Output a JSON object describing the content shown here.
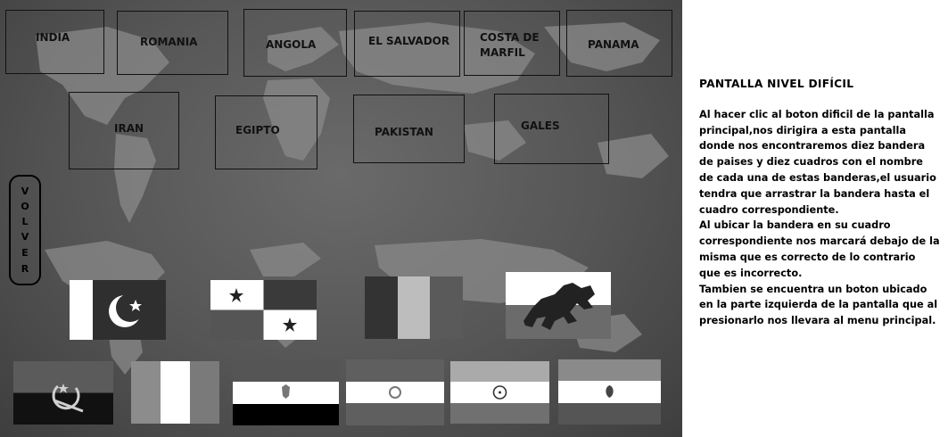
{
  "game": {
    "country_boxes": [
      {
        "id": "india",
        "label": "INDIA"
      },
      {
        "id": "romania",
        "label": "ROMANIA"
      },
      {
        "id": "angola",
        "label": "ANGOLA"
      },
      {
        "id": "el-salvador",
        "label": "EL SALVADOR"
      },
      {
        "id": "costa-de-marfil",
        "label": "COSTA DE\nMARFIL"
      },
      {
        "id": "panama",
        "label": "PANAMA"
      },
      {
        "id": "iran",
        "label": "IRAN"
      },
      {
        "id": "egipto",
        "label": "EGIPTO"
      },
      {
        "id": "pakistan",
        "label": "PAKISTAN"
      },
      {
        "id": "gales",
        "label": "GALES"
      }
    ],
    "volver_letters": [
      "V",
      "O",
      "L",
      "V",
      "E",
      "R"
    ],
    "flags": [
      {
        "id": "pakistan",
        "icon": "flag-pakistan"
      },
      {
        "id": "panama",
        "icon": "flag-panama"
      },
      {
        "id": "romania",
        "icon": "flag-romania"
      },
      {
        "id": "wales",
        "icon": "flag-wales"
      },
      {
        "id": "angola",
        "icon": "flag-angola"
      },
      {
        "id": "costa-de-marfil",
        "icon": "flag-ivory-coast"
      },
      {
        "id": "egypt",
        "icon": "flag-egypt"
      },
      {
        "id": "el-salvador",
        "icon": "flag-el-salvador"
      },
      {
        "id": "india",
        "icon": "flag-india"
      },
      {
        "id": "iran",
        "icon": "flag-iran"
      }
    ]
  },
  "description": {
    "title": "PANTALLA NIVEL DIFÍCIL",
    "body": "Al hacer clic al boton dificil de la pantalla principal,nos dirigira a esta pantalla donde nos encontraremos diez bandera de paises y diez cuadros con el nombre de cada una de estas banderas,el usuario tendra que arrastrar la bandera hasta el cuadro correspondiente.\nAl ubicar la bandera en su cuadro correspondiente nos marcará debajo de la misma que es correcto de lo contrario que es incorrecto.\nTambien se encuentra un boton ubicado en la parte izquierda de la pantalla que al presionarlo nos llevara al menu principal."
  }
}
